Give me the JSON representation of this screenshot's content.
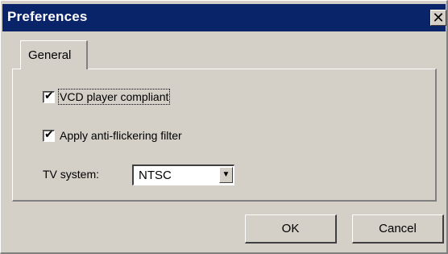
{
  "window": {
    "title": "Preferences",
    "close_glyph": "✕",
    "titlebar_color": "#0a246a",
    "face_color": "#d4d0c8"
  },
  "tabs": [
    {
      "label": "General",
      "selected": true
    }
  ],
  "general": {
    "options": [
      {
        "label": "VCD player compliant",
        "checked": true,
        "focused": true
      },
      {
        "label": "Apply anti-flickering filter",
        "checked": true,
        "focused": false
      }
    ],
    "tv_system": {
      "label": "TV system:",
      "value": "NTSC",
      "arrow_glyph": "▼"
    }
  },
  "buttons": {
    "ok": "OK",
    "cancel": "Cancel"
  }
}
